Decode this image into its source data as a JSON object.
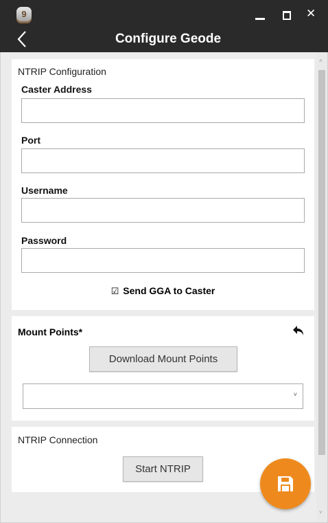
{
  "window": {
    "app_icon_text": "9",
    "title": "Configure Geode",
    "back_glyph": "<",
    "close_glyph": "✕"
  },
  "ntrip_config": {
    "section_title": "NTRIP Configuration",
    "fields": [
      {
        "label": "Caster Address",
        "value": "",
        "placeholder": ""
      },
      {
        "label": "Port",
        "value": "",
        "placeholder": ""
      },
      {
        "label": "Username",
        "value": "",
        "placeholder": ""
      },
      {
        "label": "Password",
        "value": "",
        "placeholder": ""
      }
    ],
    "send_gga_label": "Send GGA to Caster",
    "send_gga_checked": true,
    "send_gga_glyph": "☑"
  },
  "mount_points": {
    "title": "Mount Points*",
    "undo_icon": "undo-arrow-icon",
    "download_label": "Download Mount Points",
    "selected_value": "",
    "dropdown_glyph": "˅"
  },
  "ntrip_connection": {
    "section_title": "NTRIP Connection",
    "start_label": "Start NTRIP"
  },
  "fab": {
    "icon": "save-floppy-icon",
    "color": "#ee8a1d"
  },
  "scrollbar": {
    "up_glyph": "˄",
    "down_glyph": "˅"
  }
}
